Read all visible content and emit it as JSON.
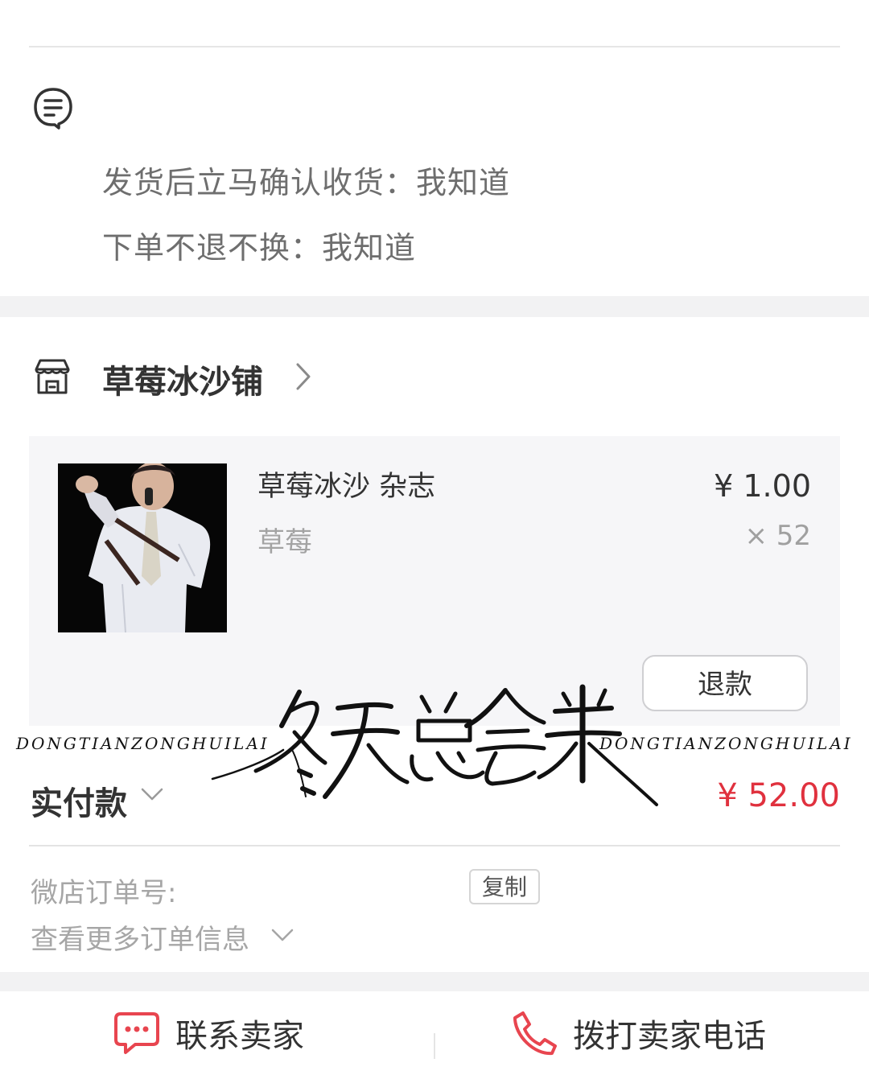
{
  "notes": [
    "发货后立马确认收货：我知道",
    "下单不退不换：我知道"
  ],
  "store": {
    "name": "草莓冰沙铺"
  },
  "item": {
    "title": "草莓冰沙 杂志",
    "variant": "草莓",
    "price": "¥ 1.00",
    "quantity": "× 52",
    "refund_label": "退款"
  },
  "payment": {
    "label": "实付款",
    "amount": "¥ 52.00"
  },
  "order": {
    "number_label": "微店订单号:",
    "copy_label": "复制",
    "more_label": "查看更多订单信息"
  },
  "actions": {
    "contact": "联系卖家",
    "call": "拨打卖家电话"
  },
  "watermark": {
    "latin_left": "DONGTIANZONGHUILAI",
    "calligraphy": "冬天总会来",
    "latin_right": "DONGTIANZONGHUILAI"
  },
  "colors": {
    "accent_red": "#e0313e",
    "icon_red": "#e8454f",
    "background": "#f2f2f3"
  },
  "icons": {
    "note": "memo-icon",
    "store": "store-icon",
    "contact": "chat-bubble-icon",
    "call": "phone-icon"
  }
}
